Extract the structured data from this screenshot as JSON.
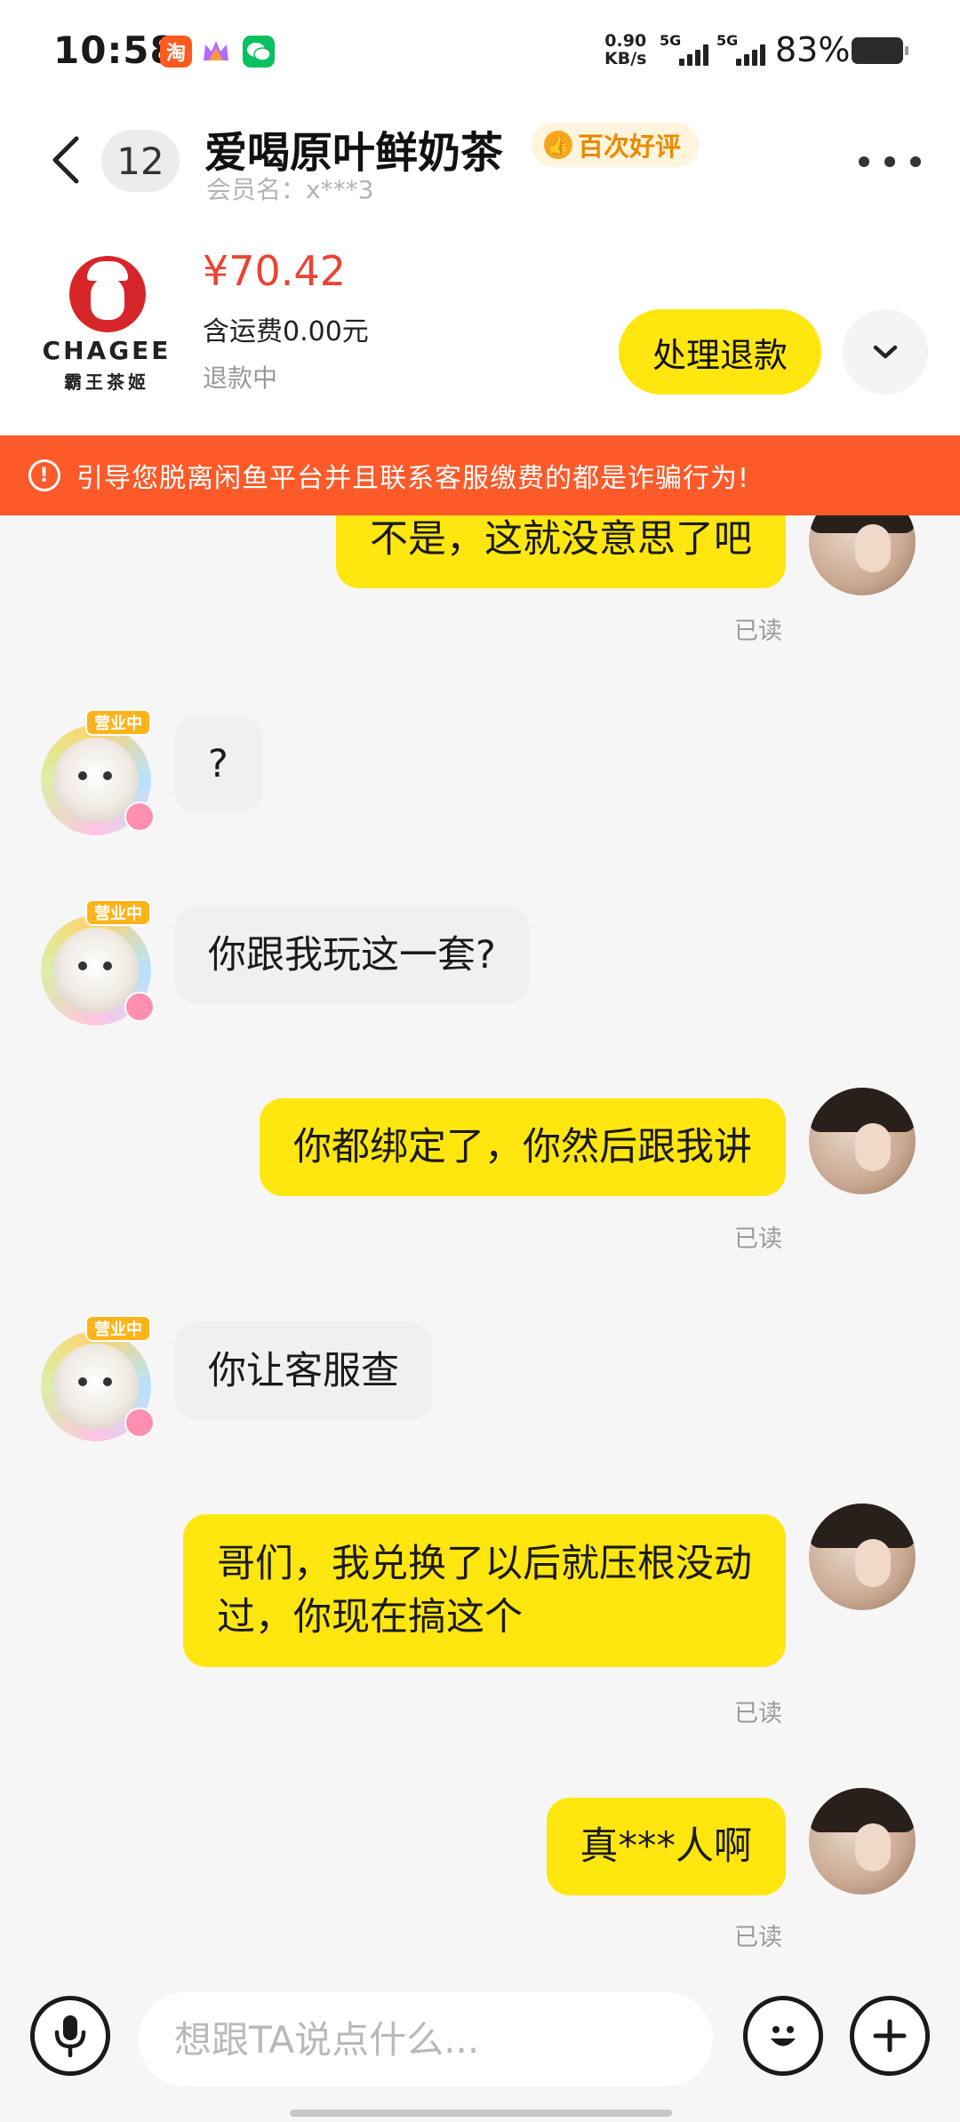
{
  "status_bar": {
    "time": "10:58",
    "app_icons": [
      {
        "name": "taobao-icon",
        "glyph": "淘"
      },
      {
        "name": "crown-app-icon",
        "glyph": "♛"
      },
      {
        "name": "wechat-icon",
        "glyph": "✆"
      }
    ],
    "net_speed_value": "0.90",
    "net_speed_unit": "KB/s",
    "signal1_label": "5G",
    "signal2_label": "5G",
    "battery": "83%"
  },
  "header": {
    "unread_count": "12",
    "shop_name": "爱喝原叶鲜奶茶",
    "review_badge": "百次好评",
    "member_label": "会员名：x***3"
  },
  "order": {
    "brand_en": "CHAGEE",
    "brand_cn": "霸王茶姬",
    "price": "¥70.42",
    "shipping": "含运费0.00元",
    "status": "退款中",
    "refund_button": "处理退款"
  },
  "warning": {
    "text": "引导您脱离闲鱼平台并且联系客服缴费的都是诈骗行为!"
  },
  "shop_avatar_tag": "营业中",
  "messages": [
    {
      "side": "out",
      "text": "不是，这就没意思了吧",
      "read": "已读"
    },
    {
      "side": "in",
      "text": "?"
    },
    {
      "side": "in",
      "text": "你跟我玩这一套?"
    },
    {
      "side": "out",
      "text": "你都绑定了，你然后跟我讲",
      "read": "已读"
    },
    {
      "side": "in",
      "text": "你让客服查"
    },
    {
      "side": "out",
      "lines": [
        "哥们，我兑换了以后就压根没动",
        "过，你现在搞这个"
      ],
      "read": "已读"
    },
    {
      "side": "out",
      "text": "真***人啊",
      "read": "已读"
    }
  ],
  "input": {
    "placeholder": "想跟TA说点什么..."
  },
  "colors": {
    "accent_yellow": "#ffe60f",
    "warning_orange": "#fd5a2a",
    "price_red": "#e94435"
  }
}
